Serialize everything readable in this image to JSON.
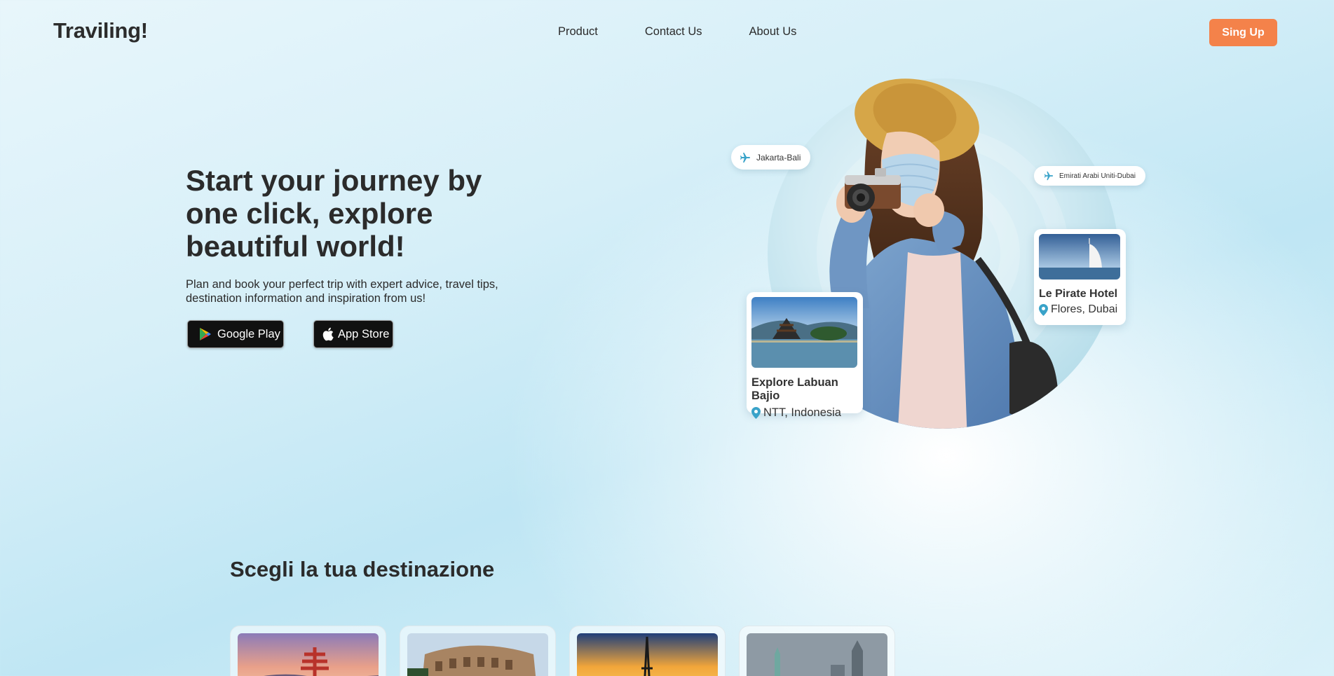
{
  "brand": {
    "logo": "Traviling!"
  },
  "nav": {
    "links": [
      "Product",
      "Contact Us",
      "About Us"
    ],
    "signup_label": "Sing Up"
  },
  "hero": {
    "title": "Start your journey by one click, explore beautiful world!",
    "subtitle": "Plan and book your perfect trip with expert advice, travel tips, destination information and inspiration from us!",
    "store_buttons": {
      "google_play": "Google Play",
      "app_store": "App Store"
    }
  },
  "badges": {
    "flight_1": "Jakarta-Bali",
    "flight_2": "Emirati Arabi Uniti-Dubai"
  },
  "cards": {
    "card_1": {
      "title": "Explore Labuan Bajio",
      "location": "NTT, Indonesia"
    },
    "card_2": {
      "title": "Le Pirate Hotel",
      "location": "Flores, Dubai"
    }
  },
  "destinations": {
    "heading": "Scegli la tua destinazione"
  },
  "colors": {
    "accent": "#f4824a",
    "pin": "#3aa3c9",
    "text": "#2b2b2b"
  }
}
